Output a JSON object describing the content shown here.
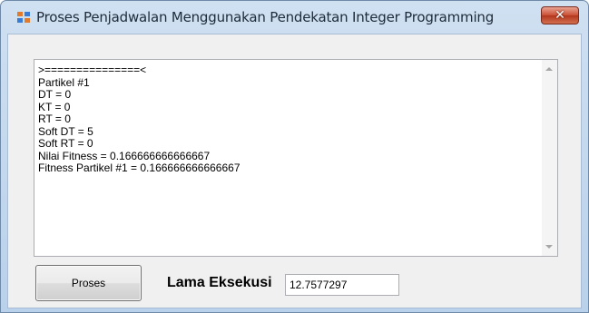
{
  "window": {
    "title": "Proses Penjadwalan Menggunakan Pendekatan Integer Programming",
    "icon": "form-icon",
    "close_glyph": "✕"
  },
  "output": {
    "lines": [
      ">===============<",
      "Partikel #1",
      "DT = 0",
      "KT = 0",
      "RT = 0",
      "Soft DT = 5",
      "Soft RT = 0",
      "Nilai Fitness = 0.166666666666667",
      "Fitness Partikel #1 = 0.166666666666667"
    ]
  },
  "controls": {
    "proses_label": "Proses",
    "lama_label": "Lama Eksekusi",
    "lama_value": "12.7577297"
  },
  "colors": {
    "titlebar": "#b9d1ea",
    "close_button": "#c94f33",
    "client_background": "#f0f0f0"
  }
}
